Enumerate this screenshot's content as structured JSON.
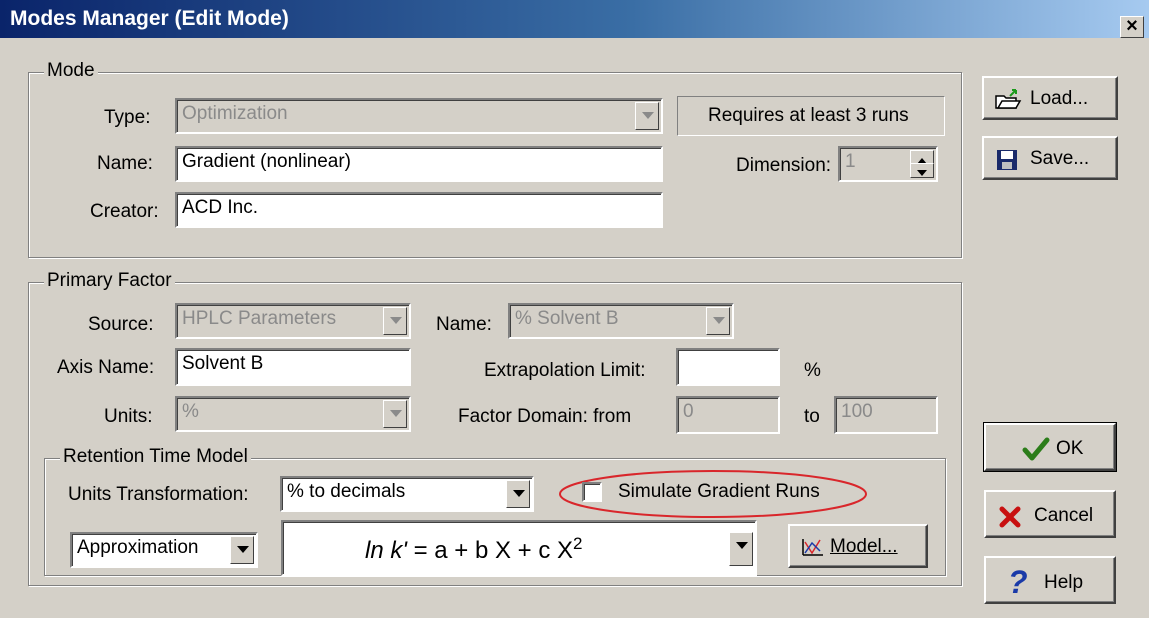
{
  "window": {
    "title": "Modes Manager (Edit Mode)",
    "close_label": "×"
  },
  "mode": {
    "legend": "Mode",
    "type_label": "Type:",
    "type_value": "Optimization",
    "name_label": "Name:",
    "name_value": "Gradient (nonlinear)",
    "creator_label": "Creator:",
    "creator_value": "ACD Inc.",
    "requires_text": "Requires at least 3 runs",
    "dimension_label": "Dimension:",
    "dimension_value": "1"
  },
  "primary": {
    "legend": "Primary Factor",
    "source_label": "Source:",
    "source_value": "HPLC Parameters",
    "name_label": "Name:",
    "name_value": "% Solvent B",
    "axis_label": "Axis Name:",
    "axis_value": "Solvent B",
    "units_label": "Units:",
    "units_value": "%",
    "extrap_label": "Extrapolation Limit:",
    "extrap_value": "",
    "extrap_unit": "%",
    "domain_label": "Factor Domain:  from",
    "domain_from": "0",
    "domain_to_label": "to",
    "domain_to": "100"
  },
  "rtm": {
    "legend": "Retention Time Model",
    "units_transform_label": "Units Transformation:",
    "units_transform_value": "% to decimals",
    "simulate_label": "Simulate Gradient Runs",
    "approx_value": "Approximation",
    "formula_prefix": "ln k'",
    "formula_main": " = a + b X + c X",
    "formula_sup": "2",
    "model_label": "Model..."
  },
  "buttons": {
    "load": "Load...",
    "save": "Save...",
    "ok": "OK",
    "cancel": "Cancel",
    "help": "Help"
  },
  "colors": {
    "title_bar": "#0a246a",
    "highlight_ellipse": "#d9262b",
    "ok_check": "#2c7d1a",
    "cancel_x": "#c81010",
    "help_q": "#1a3aa8"
  }
}
